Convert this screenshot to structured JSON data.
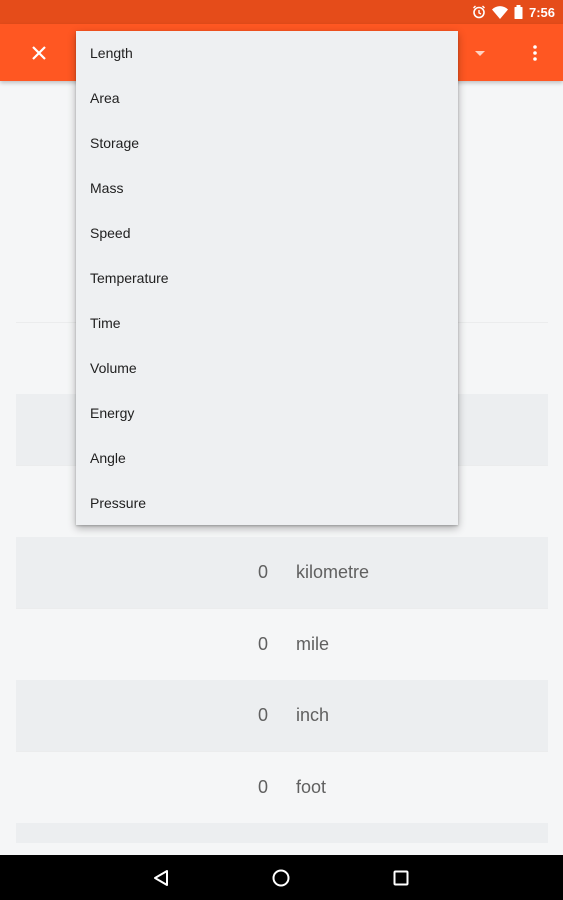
{
  "status_bar": {
    "time": "7:56",
    "icons": [
      "alarm-icon",
      "wifi-icon",
      "battery-icon"
    ]
  },
  "toolbar": {
    "close_icon": "close-icon",
    "caret_icon": "dropdown-caret-icon",
    "overflow_icon": "overflow-menu-icon",
    "background": "#ff5722"
  },
  "category_menu": {
    "items": [
      "Length",
      "Area",
      "Storage",
      "Mass",
      "Speed",
      "Temperature",
      "Time",
      "Volume",
      "Energy",
      "Angle",
      "Pressure"
    ]
  },
  "conversion_rows": [
    {
      "value": "",
      "unit": ""
    },
    {
      "value": "",
      "unit": ""
    },
    {
      "value": "",
      "unit": ""
    },
    {
      "value": "0",
      "unit": "kilometre"
    },
    {
      "value": "0",
      "unit": "mile"
    },
    {
      "value": "0",
      "unit": "inch"
    },
    {
      "value": "0",
      "unit": "foot"
    }
  ],
  "nav_bar": {
    "buttons": [
      "back-icon",
      "home-icon",
      "recents-icon"
    ]
  }
}
